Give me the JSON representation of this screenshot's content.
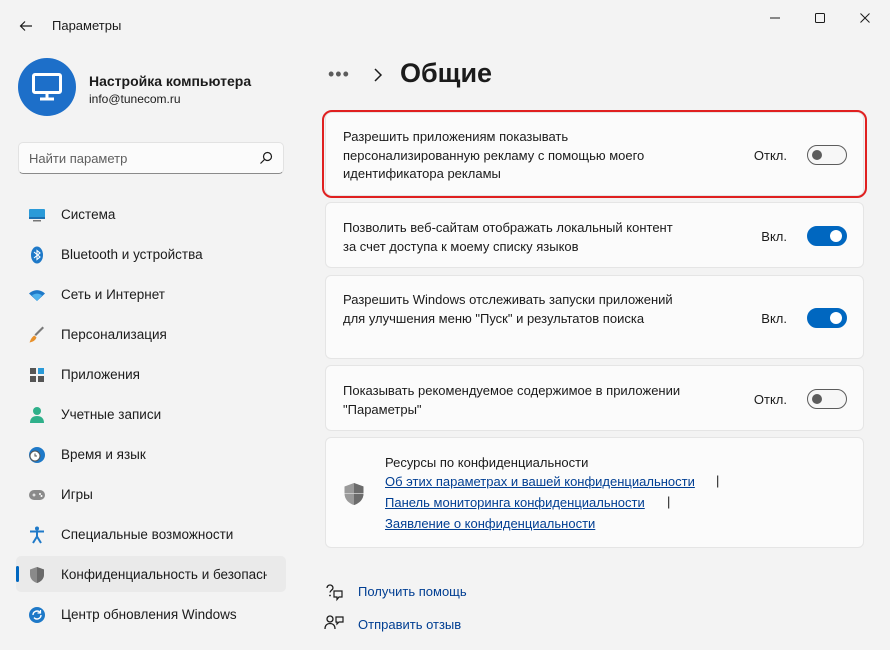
{
  "app": {
    "title": "Параметры"
  },
  "profile": {
    "name": "Настройка компьютера",
    "email": "info@tunecom.ru"
  },
  "search": {
    "placeholder": "Найти параметр"
  },
  "nav": {
    "items": [
      {
        "label": "Система",
        "icon": "system-icon"
      },
      {
        "label": "Bluetooth и устройства",
        "icon": "bluetooth-icon"
      },
      {
        "label": "Сеть и Интернет",
        "icon": "wifi-icon"
      },
      {
        "label": "Персонализация",
        "icon": "brush-icon"
      },
      {
        "label": "Приложения",
        "icon": "apps-icon"
      },
      {
        "label": "Учетные записи",
        "icon": "account-icon"
      },
      {
        "label": "Время и язык",
        "icon": "clock-globe-icon"
      },
      {
        "label": "Игры",
        "icon": "gamepad-icon"
      },
      {
        "label": "Специальные возможности",
        "icon": "accessibility-icon"
      },
      {
        "label": "Конфиденциальность и безопасность",
        "icon": "shield-icon",
        "active": true
      },
      {
        "label": "Центр обновления Windows",
        "icon": "update-icon"
      }
    ]
  },
  "breadcrumb": {
    "more": "•••",
    "title": "Общие"
  },
  "settings": [
    {
      "text": "Разрешить приложениям показывать персонализированную рекламу с помощью моего идентификатора рекламы",
      "state": "Откл.",
      "on": false
    },
    {
      "text": "Позволить веб-сайтам отображать локальный контент за счет доступа к моему списку языков",
      "state": "Вкл.",
      "on": true
    },
    {
      "text": "Разрешить Windows отслеживать запуски приложений для улучшения меню \"Пуск\" и результатов поиска",
      "state": "Вкл.",
      "on": true
    },
    {
      "text": "Показывать рекомендуемое содержимое в приложении \"Параметры\"",
      "state": "Откл.",
      "on": false
    }
  ],
  "resources": {
    "title": "Ресурсы по конфиденциальности",
    "links": [
      "Об этих параметрах и вашей конфиденциальности",
      "Панель мониторинга конфиденциальности",
      "Заявление о конфиденциальности"
    ],
    "separator": "|"
  },
  "footer": {
    "help": "Получить помощь",
    "feedback": "Отправить отзыв"
  },
  "colors": {
    "accent": "#0067c0",
    "highlight": "#e02020",
    "link": "#003e92"
  }
}
